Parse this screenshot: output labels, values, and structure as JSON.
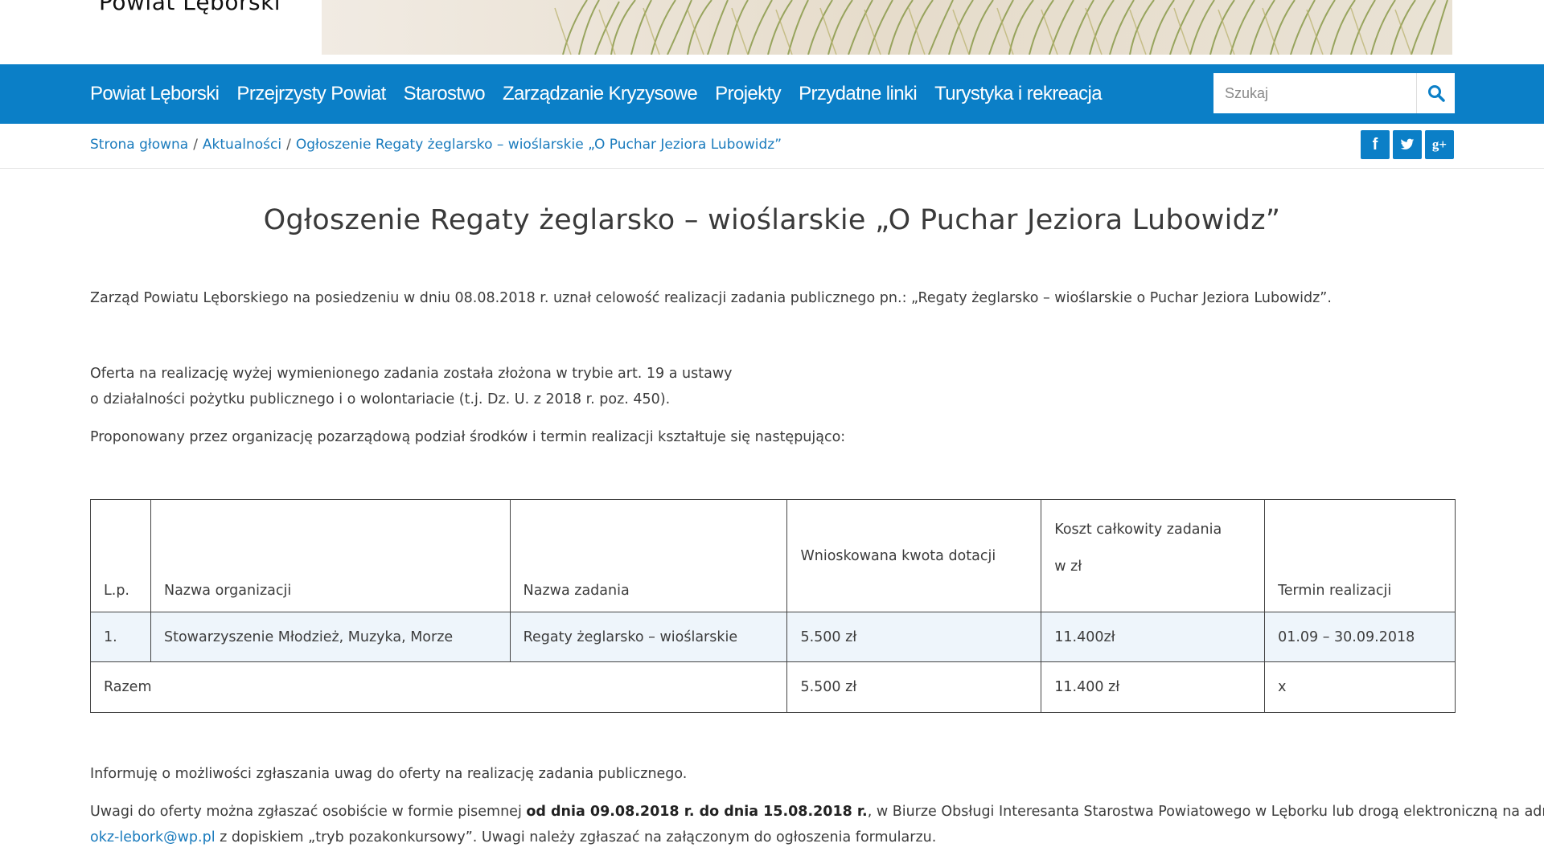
{
  "header": {
    "logo_text": "Powiat Lęborski"
  },
  "nav": {
    "items": [
      {
        "label": "Powiat Lęborski"
      },
      {
        "label": "Przejrzysty Powiat"
      },
      {
        "label": "Starostwo"
      },
      {
        "label": "Zarządzanie Kryzysowe"
      },
      {
        "label": "Projekty"
      },
      {
        "label": "Przydatne linki"
      },
      {
        "label": "Turystyka i rekreacja"
      }
    ],
    "search_placeholder": "Szukaj",
    "accent_color": "#0b7fc7"
  },
  "breadcrumb": {
    "items": [
      {
        "label": "Strona głowna"
      },
      {
        "label": "Aktualności"
      },
      {
        "label": "Ogłoszenie Regaty żeglarsko – wioślarskie „O Puchar Jeziora Lubowidz”"
      }
    ],
    "separator": "/"
  },
  "social": {
    "facebook": "f",
    "googleplus": "g+"
  },
  "article": {
    "title": "Ogłoszenie Regaty żeglarsko – wioślarskie „O Puchar Jeziora Lubowidz”",
    "p1": "Zarząd Powiatu Lęborskiego na posiedzeniu w dniu 08.08.2018 r. uznał celowość realizacji zadania publicznego pn.: „Regaty żeglarsko – wioślarskie o Puchar Jeziora Lubowidz”.",
    "p2_line1": "Oferta na realizację wyżej wymienionego zadania została złożona w trybie art. 19 a ustawy",
    "p2_line2": "o działalności pożytku publicznego i o wolontariacie (t.j. Dz. U. z 2018 r. poz. 450).",
    "p3": "Proponowany przez organizację pozarządową podział środków i termin realizacji kształtuje się następująco:",
    "p4": "Informuję o możliwości zgłaszania uwag do oferty na realizację zadania publicznego.",
    "p5_pre": "Uwagi do oferty można zgłaszać osobiście w formie pisemnej ",
    "p5_bold": "od dnia 09.08.2018 r. do dnia 15.08.2018 r.",
    "p5_post": ", w Biurze Obsługi Interesanta Starostwa Powiatowego w Lęborku lub drogą elektroniczną na adres:",
    "p6_email": "okz-lebork@wp.pl",
    "p6_post": " z dopiskiem „tryb pozakonkursowy”. Uwagi należy zgłaszać na załączonym do ogłoszenia formularzu."
  },
  "table": {
    "headers": {
      "lp": "L.p.",
      "org": "Nazwa organizacji",
      "task": "Nazwa zadania",
      "grant": "Wnioskowana kwota dotacji",
      "cost_line1": "Koszt całkowity zadania",
      "cost_line2": "w zł",
      "term": "Termin realizacji"
    },
    "rows": [
      {
        "lp": "1.",
        "org": "Stowarzyszenie Młodzież, Muzyka, Morze",
        "task": "Regaty żeglarsko – wioślarskie",
        "grant": "5.500 zł",
        "cost": "11.400zł",
        "term": "01.09 – 30.09.2018"
      }
    ],
    "total": {
      "label": "Razem",
      "grant": "5.500 zł",
      "cost": "11.400 zł",
      "term": "x"
    }
  }
}
